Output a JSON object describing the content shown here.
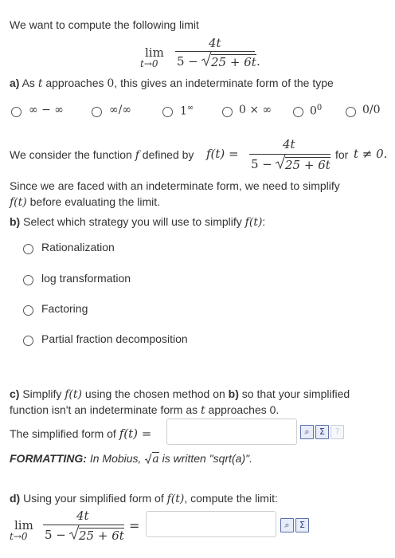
{
  "intro": "We want to compute the following limit",
  "limit_top": {
    "lim": "lim",
    "sub": "t→0",
    "numerator": "4t",
    "den_a": "5 −",
    "den_b": "25 + 6t",
    "period": "."
  },
  "part_a": {
    "label": "a)",
    "text_1": " As ",
    "var_t": "t",
    "text_2": " approaches ",
    "zero": "0",
    "text_3": ", this gives an indeterminate form of the type",
    "options": [
      "∞ − ∞",
      "∞/∞",
      "1∞",
      "0 × ∞",
      "00",
      "0/0"
    ],
    "opt_1inf_base": "1",
    "opt_1inf_exp": "∞",
    "opt_00_base": "0",
    "opt_00_exp": "0"
  },
  "define": {
    "text_1": "We consider the function ",
    "f": "f",
    "text_2": " defined by ",
    "ft": "f(t) =",
    "numerator": "4t",
    "den_a": "5 −",
    "den_b": "25 + 6t",
    "text_3": "for",
    "cond": "t ≠ 0.",
    "since_1": "Since we are faced with an indeterminate form, we need to simplify",
    "since_2a": "f(t)",
    "since_2b": " before evaluating the limit."
  },
  "part_b": {
    "label": "b)",
    "text": " Select which strategy you will use to simplify ",
    "ft": "f(t)",
    "colon": ":",
    "options": [
      "Rationalization",
      "log transformation",
      "Factoring",
      "Partial fraction decomposition"
    ]
  },
  "part_c": {
    "label": "c)",
    "text_1": " Simplify ",
    "ft": "f(t)",
    "text_2": " using the chosen method on ",
    "b": "b)",
    "text_3": " so that your simplified",
    "line2_a": "function isn't an indeterminate form as ",
    "t": "t",
    "line2_b": " approaches 0.",
    "simplified": "The simplified form of ",
    "ft2": "f(t) =",
    "input_value": "",
    "fmt_label": "FORMATTING:",
    "fmt_1": " In Mobius, ",
    "fmt_a": "a",
    "fmt_2": " is written \"sqrt(a)\"."
  },
  "part_d": {
    "label": "d)",
    "text_1": " Using your simplified form of ",
    "ft": "f(t)",
    "text_2": ", compute the limit:",
    "lim": "lim",
    "sub": "t→0",
    "numerator": "4t",
    "den_a": "5 −",
    "den_b": "25 + 6t",
    "eq": "=",
    "input_value": ""
  },
  "icons": {
    "preview": "preview-icon",
    "equation_editor": "equation-editor-icon",
    "help": "help-icon"
  },
  "colors": {
    "text": "#333333",
    "icon_border": "#5b6fa8",
    "input_border": "#cfcfcf"
  }
}
